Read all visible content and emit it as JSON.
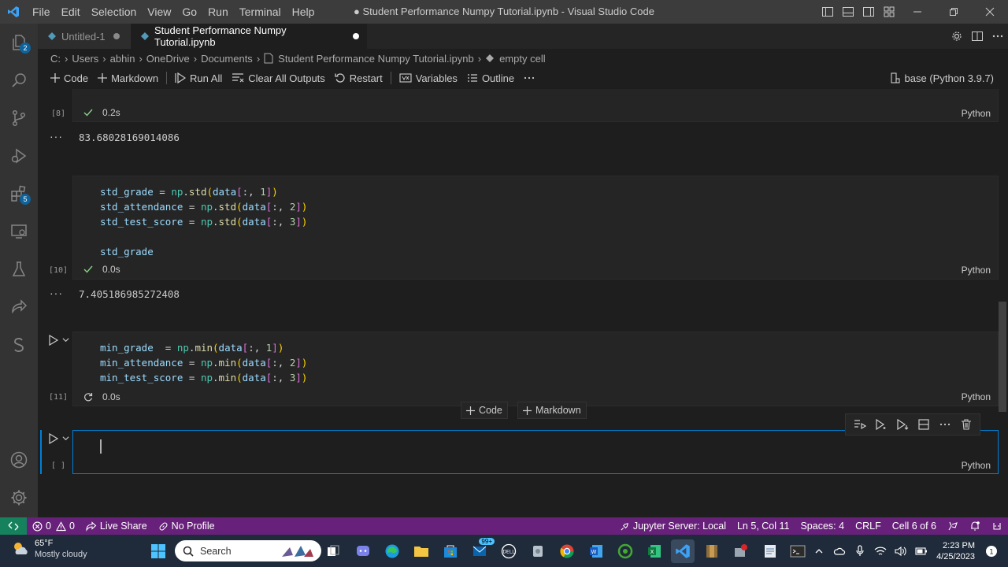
{
  "window": {
    "menu": [
      "File",
      "Edit",
      "Selection",
      "View",
      "Go",
      "Run",
      "Terminal",
      "Help"
    ],
    "title": "● Student Performance Numpy Tutorial.ipynb - Visual Studio Code"
  },
  "activity_bar": {
    "explorer_badge": "2",
    "extensions_badge": "5"
  },
  "tabs": [
    {
      "label": "Untitled-1",
      "active": false
    },
    {
      "label": "Student Performance Numpy Tutorial.ipynb",
      "active": true
    }
  ],
  "breadcrumb": [
    "C:",
    "Users",
    "abhin",
    "OneDrive",
    "Documents",
    "Student Performance Numpy Tutorial.ipynb",
    "empty cell"
  ],
  "toolbar": {
    "code_label": "Code",
    "markdown_label": "Markdown",
    "run_all_label": "Run All",
    "clear_outputs_label": "Clear All Outputs",
    "restart_label": "Restart",
    "variables_label": "Variables",
    "outline_label": "Outline",
    "kernel_label": "base (Python 3.9.7)"
  },
  "cells": {
    "cell8": {
      "exec": "[8]",
      "time": "0.2s",
      "lang": "Python",
      "output": "83.68028169014086"
    },
    "cell10": {
      "exec": "[10]",
      "time": "0.0s",
      "lang": "Python",
      "output": "7.405186985272408",
      "lines": [
        "std_grade = np.std(data[:, 1])",
        "std_attendance = np.std(data[:, 2])",
        "std_test_score = np.std(data[:, 3])",
        "",
        "std_grade"
      ]
    },
    "cell11": {
      "exec": "[11]",
      "time": "0.0s",
      "lang": "Python",
      "lines": [
        "min_grade  = np.min(data[:, 1])",
        "min_attendance = np.min(data[:, 2])",
        "min_test_score = np.min(data[:, 3])"
      ]
    },
    "empty": {
      "exec": "[ ]",
      "lang": "Python"
    }
  },
  "insert_buttons": {
    "code": "Code",
    "markdown": "Markdown"
  },
  "statusbar": {
    "errors": "0",
    "warnings": "0",
    "live_share": "Live Share",
    "profile": "No Profile",
    "jupyter": "Jupyter Server: Local",
    "position": "Ln 5, Col 11",
    "spaces": "Spaces: 4",
    "eol": "CRLF",
    "cell": "Cell 6 of 6"
  },
  "taskbar": {
    "temp": "65°F",
    "weather": "Mostly cloudy",
    "search_placeholder": "Search",
    "teams_badge": "99+",
    "time": "2:23 PM",
    "date": "4/25/2023"
  },
  "colors": {
    "statusbar": "#68217a",
    "remote": "#16825d",
    "accent": "#0e639c",
    "focus_border": "#007fd4"
  }
}
